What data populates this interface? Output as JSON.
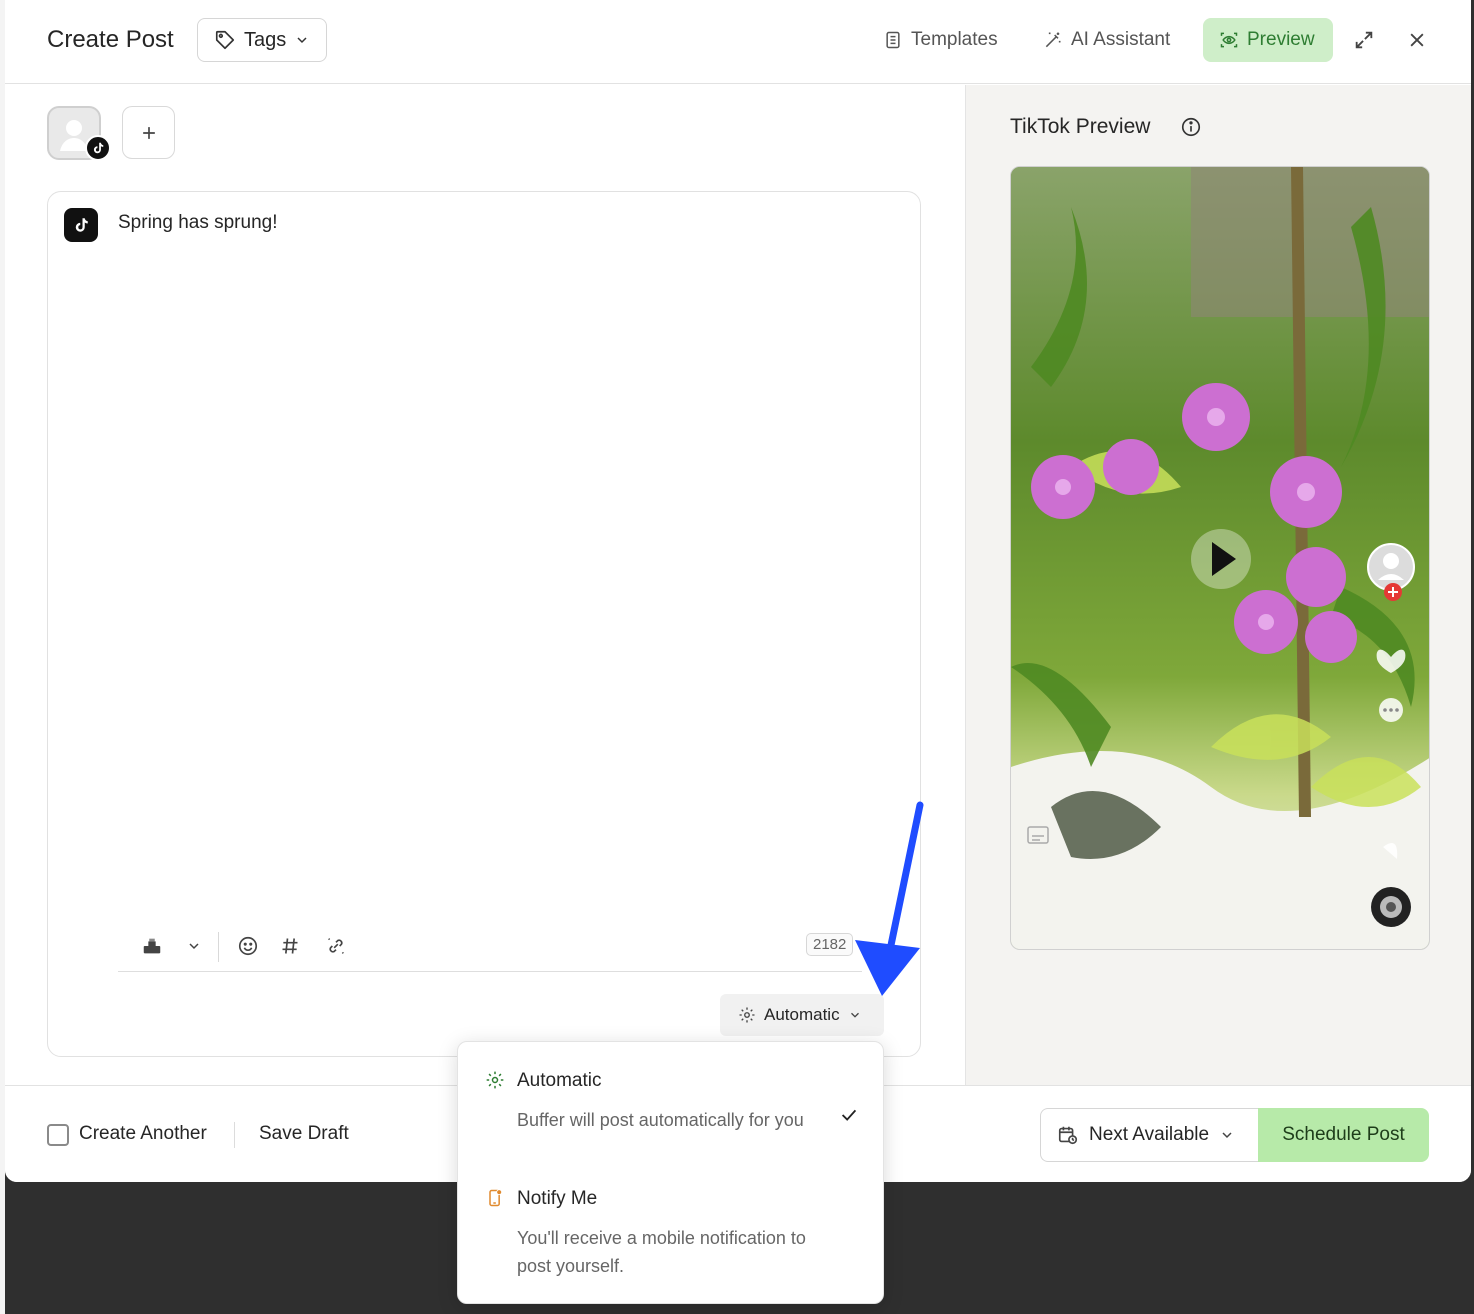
{
  "header": {
    "title": "Create Post",
    "tags_label": "Tags",
    "templates_label": "Templates",
    "ai_label": "AI Assistant",
    "preview_label": "Preview"
  },
  "editor": {
    "text": "Spring has sprung!",
    "char_count": "2182",
    "share_mode": "Automatic"
  },
  "preview": {
    "title": "TikTok Preview"
  },
  "footer": {
    "create_another": "Create Another",
    "save_draft": "Save Draft",
    "next_available": "Next Available",
    "schedule": "Schedule Post"
  },
  "dropdown": {
    "items": [
      {
        "title": "Automatic",
        "desc": "Buffer will post automatically for you",
        "selected": true,
        "icon": "gear-icon"
      },
      {
        "title": "Notify Me",
        "desc": "You'll receive a mobile notification to post yourself.",
        "selected": false,
        "icon": "phone-notification-icon"
      }
    ]
  },
  "colors": {
    "accent_green": "#2e7d32",
    "preview_bg": "#cfeec9",
    "schedule_bg": "#b7eaa9",
    "annotation_arrow": "#1f4cff"
  }
}
